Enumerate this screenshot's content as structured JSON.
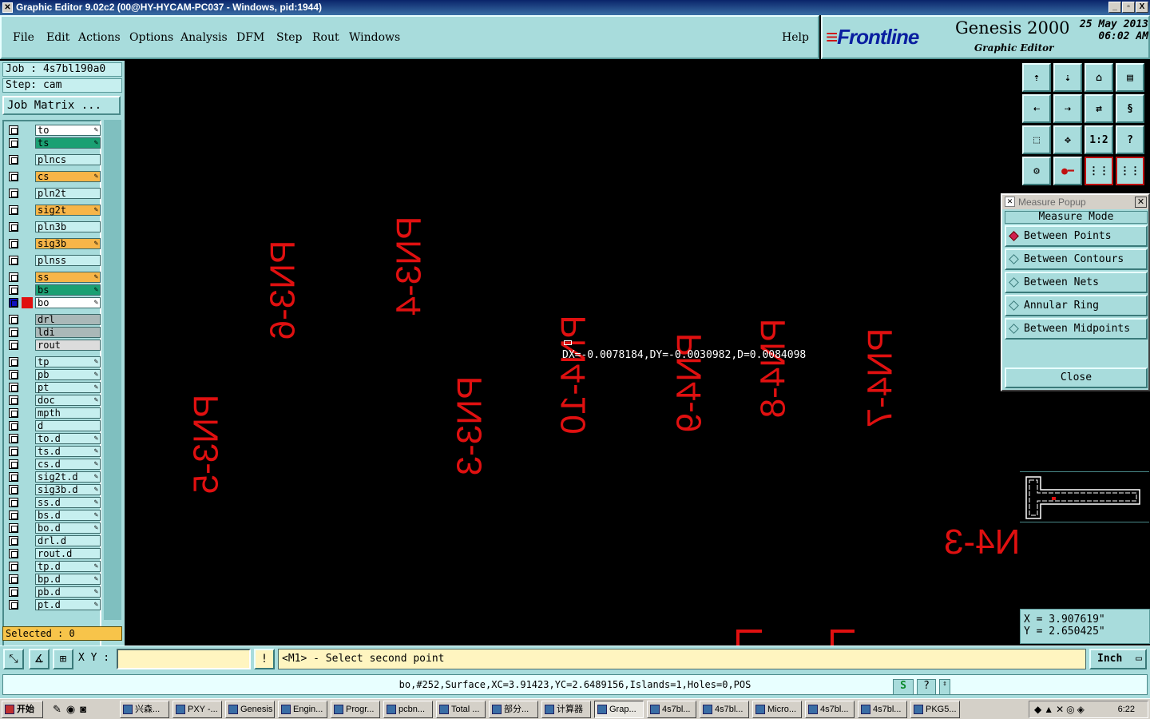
{
  "window": {
    "title": "Graphic Editor 9.02c2 (00@HY-HYCAM-PC037 - Windows, pid:1944)",
    "controls": [
      "_",
      "▫",
      "X"
    ]
  },
  "menu": {
    "items": [
      "File",
      "Edit",
      "Actions",
      "Options",
      "Analysis",
      "DFM",
      "Step",
      "Rout",
      "Windows"
    ],
    "help": "Help"
  },
  "brand": {
    "logo": "Frontline",
    "product": "Genesis 2000",
    "subtitle": "Graphic Editor",
    "date": "25 May 2013",
    "time": "06:02 AM"
  },
  "job": {
    "job_line": "Job : 4s7bl190a0",
    "step_line": "Step: cam",
    "matrix_button": "Job Matrix ..."
  },
  "layers": [
    {
      "name": "to",
      "color": "#ffffff",
      "editable": true
    },
    {
      "name": "ts",
      "color": "#1aa073",
      "editable": true
    },
    {
      "name": "plncs",
      "color": "#c6efef",
      "editable": false
    },
    {
      "name": "cs",
      "color": "#f7b548",
      "editable": true
    },
    {
      "name": "pln2t",
      "color": "#c6efef",
      "editable": false
    },
    {
      "name": "sig2t",
      "color": "#f7b548",
      "editable": true
    },
    {
      "name": "pln3b",
      "color": "#c6efef",
      "editable": false
    },
    {
      "name": "sig3b",
      "color": "#f7b548",
      "editable": true
    },
    {
      "name": "plnss",
      "color": "#c6efef",
      "editable": false
    },
    {
      "name": "ss",
      "color": "#f7b548",
      "editable": true
    },
    {
      "name": "bs",
      "color": "#1aa073",
      "editable": true
    },
    {
      "name": "bo",
      "color": "#ffffff",
      "editable": true,
      "active": true
    },
    {
      "name": "drl",
      "color": "#aab8b8",
      "editable": false
    },
    {
      "name": "ldi",
      "color": "#aab8b8",
      "editable": false
    },
    {
      "name": "rout",
      "color": "#dcdcdc",
      "editable": false
    },
    {
      "name": "tp",
      "color": "#c6efef",
      "editable": true
    },
    {
      "name": "pb",
      "color": "#c6efef",
      "editable": true
    },
    {
      "name": "pt",
      "color": "#c6efef",
      "editable": true
    },
    {
      "name": "doc",
      "color": "#c6efef",
      "editable": true
    },
    {
      "name": "mpth",
      "color": "#c6efef",
      "editable": false
    },
    {
      "name": "d",
      "color": "#c6efef",
      "editable": false
    },
    {
      "name": "to.d",
      "color": "#c6efef",
      "editable": true
    },
    {
      "name": "ts.d",
      "color": "#c6efef",
      "editable": true
    },
    {
      "name": "cs.d",
      "color": "#c6efef",
      "editable": true
    },
    {
      "name": "sig2t.d",
      "color": "#c6efef",
      "editable": true
    },
    {
      "name": "sig3b.d",
      "color": "#c6efef",
      "editable": true
    },
    {
      "name": "ss.d",
      "color": "#c6efef",
      "editable": true
    },
    {
      "name": "bs.d",
      "color": "#c6efef",
      "editable": true
    },
    {
      "name": "bo.d",
      "color": "#c6efef",
      "editable": true
    },
    {
      "name": "drl.d",
      "color": "#c6efef",
      "editable": false
    },
    {
      "name": "rout.d",
      "color": "#c6efef",
      "editable": false
    },
    {
      "name": "tp.d",
      "color": "#c6efef",
      "editable": true
    },
    {
      "name": "bp.d",
      "color": "#c6efef",
      "editable": true
    },
    {
      "name": "pb.d",
      "color": "#c6efef",
      "editable": true
    },
    {
      "name": "pt.d",
      "color": "#c6efef",
      "editable": true
    }
  ],
  "selected": "Selected : 0",
  "canvas": {
    "labels": [
      "PN3-5",
      "PN3-6",
      "PN3-4",
      "PN3-3",
      "PN4-10",
      "PN4-9",
      "PN4-8",
      "PN4-7",
      "N4-3"
    ],
    "measure": "DX=-0.0078184,DY=-0.0030982,D=0.0084098"
  },
  "measure_popup": {
    "title": "Measure Popup",
    "mode_label": "Measure Mode",
    "options": [
      "Between Points",
      "Between Contours",
      "Between Nets",
      "Annular Ring",
      "Between Midpoints"
    ],
    "selected_index": 0,
    "close": "Close"
  },
  "toolbox": {
    "zoom_ratio_label": "1:2",
    "help_label": "?"
  },
  "coords": {
    "x": "X = 3.907619\"",
    "y": "Y = 2.650425\""
  },
  "command": {
    "xy_label": "X Y :",
    "xy_value": "",
    "info_icon": "!",
    "prompt": "<M1> - Select second point",
    "units": "Inch"
  },
  "status": {
    "text": "bo,#252,Surface,XC=3.91423,YC=2.6489156,Islands=1,Holes=0,POS"
  },
  "taskbar": {
    "start": "开始",
    "tasks": [
      "兴森...",
      "PXY -...",
      "Genesis",
      "Engin...",
      "Progr...",
      "pcbn...",
      "Total ...",
      "部分...",
      "计算器",
      "Grap...",
      "4s7bl...",
      "4s7bl...",
      "Micro...",
      "4s7bl...",
      "4s7bl...",
      "PKG5..."
    ],
    "active_task": "Grap...",
    "clock": "6:22"
  }
}
